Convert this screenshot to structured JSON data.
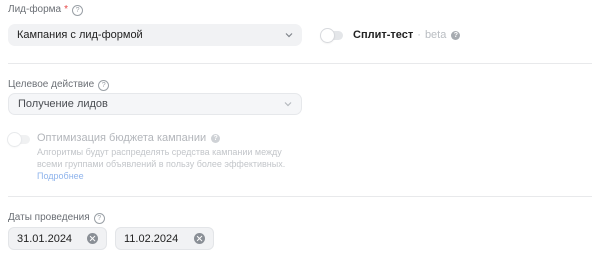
{
  "lead_form": {
    "label": "Лид-форма",
    "required_mark": "*",
    "selected": "Кампания с лид-формой"
  },
  "split_test": {
    "label": "Сплит-тест",
    "separator": "·",
    "badge": "beta",
    "enabled": false
  },
  "target_action": {
    "label": "Целевое действие",
    "selected": "Получение лидов"
  },
  "budget_optimization": {
    "title": "Оптимизация бюджета кампании",
    "description": "Алгоритмы будут распределять средства кампании между всеми группами объявлений в пользу более эффективных.",
    "link": "Подробнее",
    "enabled": false
  },
  "dates": {
    "label": "Даты проведения",
    "start": "31.01.2024",
    "end": "11.02.2024"
  },
  "icons": {
    "help": "question-circle-icon",
    "dropdown": "chevron-down-icon",
    "clear": "clear-x-icon"
  }
}
